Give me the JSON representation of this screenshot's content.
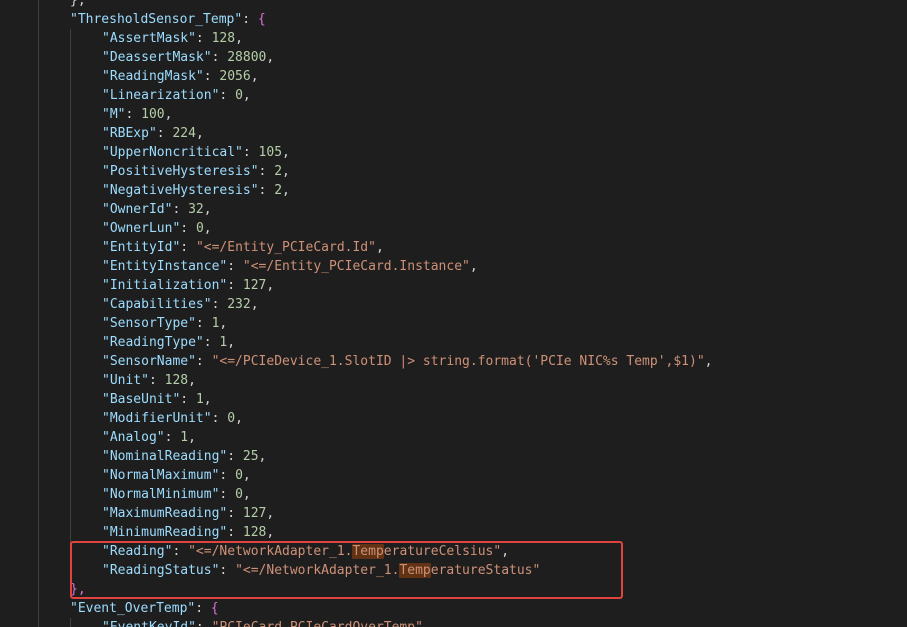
{
  "editor": {
    "lines": [
      {
        "indent": 1,
        "parts": [
          {
            "t": "},",
            "c": "punc"
          }
        ]
      },
      {
        "indent": 1,
        "parts": [
          {
            "t": "\"ThresholdSensor_Temp\"",
            "c": "key"
          },
          {
            "t": ": ",
            "c": "punc"
          },
          {
            "t": "{",
            "c": "brace2"
          }
        ]
      },
      {
        "indent": 2,
        "parts": [
          {
            "t": "\"AssertMask\"",
            "c": "key"
          },
          {
            "t": ": ",
            "c": "punc"
          },
          {
            "t": "128",
            "c": "num"
          },
          {
            "t": ",",
            "c": "punc"
          }
        ]
      },
      {
        "indent": 2,
        "parts": [
          {
            "t": "\"DeassertMask\"",
            "c": "key"
          },
          {
            "t": ": ",
            "c": "punc"
          },
          {
            "t": "28800",
            "c": "num"
          },
          {
            "t": ",",
            "c": "punc"
          }
        ]
      },
      {
        "indent": 2,
        "parts": [
          {
            "t": "\"ReadingMask\"",
            "c": "key"
          },
          {
            "t": ": ",
            "c": "punc"
          },
          {
            "t": "2056",
            "c": "num"
          },
          {
            "t": ",",
            "c": "punc"
          }
        ]
      },
      {
        "indent": 2,
        "parts": [
          {
            "t": "\"Linearization\"",
            "c": "key"
          },
          {
            "t": ": ",
            "c": "punc"
          },
          {
            "t": "0",
            "c": "num"
          },
          {
            "t": ",",
            "c": "punc"
          }
        ]
      },
      {
        "indent": 2,
        "parts": [
          {
            "t": "\"M\"",
            "c": "key"
          },
          {
            "t": ": ",
            "c": "punc"
          },
          {
            "t": "100",
            "c": "num"
          },
          {
            "t": ",",
            "c": "punc"
          }
        ]
      },
      {
        "indent": 2,
        "parts": [
          {
            "t": "\"RBExp\"",
            "c": "key"
          },
          {
            "t": ": ",
            "c": "punc"
          },
          {
            "t": "224",
            "c": "num"
          },
          {
            "t": ",",
            "c": "punc"
          }
        ]
      },
      {
        "indent": 2,
        "parts": [
          {
            "t": "\"UpperNoncritical\"",
            "c": "key"
          },
          {
            "t": ": ",
            "c": "punc"
          },
          {
            "t": "105",
            "c": "num"
          },
          {
            "t": ",",
            "c": "punc"
          }
        ]
      },
      {
        "indent": 2,
        "parts": [
          {
            "t": "\"PositiveHysteresis\"",
            "c": "key"
          },
          {
            "t": ": ",
            "c": "punc"
          },
          {
            "t": "2",
            "c": "num"
          },
          {
            "t": ",",
            "c": "punc"
          }
        ]
      },
      {
        "indent": 2,
        "parts": [
          {
            "t": "\"NegativeHysteresis\"",
            "c": "key"
          },
          {
            "t": ": ",
            "c": "punc"
          },
          {
            "t": "2",
            "c": "num"
          },
          {
            "t": ",",
            "c": "punc"
          }
        ]
      },
      {
        "indent": 2,
        "parts": [
          {
            "t": "\"OwnerId\"",
            "c": "key"
          },
          {
            "t": ": ",
            "c": "punc"
          },
          {
            "t": "32",
            "c": "num"
          },
          {
            "t": ",",
            "c": "punc"
          }
        ]
      },
      {
        "indent": 2,
        "parts": [
          {
            "t": "\"OwnerLun\"",
            "c": "key"
          },
          {
            "t": ": ",
            "c": "punc"
          },
          {
            "t": "0",
            "c": "num"
          },
          {
            "t": ",",
            "c": "punc"
          }
        ]
      },
      {
        "indent": 2,
        "parts": [
          {
            "t": "\"EntityId\"",
            "c": "key"
          },
          {
            "t": ": ",
            "c": "punc"
          },
          {
            "t": "\"<=/Entity_PCIeCard.Id\"",
            "c": "str"
          },
          {
            "t": ",",
            "c": "punc"
          }
        ]
      },
      {
        "indent": 2,
        "parts": [
          {
            "t": "\"EntityInstance\"",
            "c": "key"
          },
          {
            "t": ": ",
            "c": "punc"
          },
          {
            "t": "\"<=/Entity_PCIeCard.Instance\"",
            "c": "str"
          },
          {
            "t": ",",
            "c": "punc"
          }
        ]
      },
      {
        "indent": 2,
        "parts": [
          {
            "t": "\"Initialization\"",
            "c": "key"
          },
          {
            "t": ": ",
            "c": "punc"
          },
          {
            "t": "127",
            "c": "num"
          },
          {
            "t": ",",
            "c": "punc"
          }
        ]
      },
      {
        "indent": 2,
        "parts": [
          {
            "t": "\"Capabilities\"",
            "c": "key"
          },
          {
            "t": ": ",
            "c": "punc"
          },
          {
            "t": "232",
            "c": "num"
          },
          {
            "t": ",",
            "c": "punc"
          }
        ]
      },
      {
        "indent": 2,
        "parts": [
          {
            "t": "\"SensorType\"",
            "c": "key"
          },
          {
            "t": ": ",
            "c": "punc"
          },
          {
            "t": "1",
            "c": "num"
          },
          {
            "t": ",",
            "c": "punc"
          }
        ]
      },
      {
        "indent": 2,
        "parts": [
          {
            "t": "\"ReadingType\"",
            "c": "key"
          },
          {
            "t": ": ",
            "c": "punc"
          },
          {
            "t": "1",
            "c": "num"
          },
          {
            "t": ",",
            "c": "punc"
          }
        ]
      },
      {
        "indent": 2,
        "parts": [
          {
            "t": "\"SensorName\"",
            "c": "key"
          },
          {
            "t": ": ",
            "c": "punc"
          },
          {
            "t": "\"<=/PCIeDevice_1.SlotID |> string.format('PCIe NIC%s Temp',$1)\"",
            "c": "str"
          },
          {
            "t": ",",
            "c": "punc"
          }
        ]
      },
      {
        "indent": 2,
        "parts": [
          {
            "t": "\"Unit\"",
            "c": "key"
          },
          {
            "t": ": ",
            "c": "punc"
          },
          {
            "t": "128",
            "c": "num"
          },
          {
            "t": ",",
            "c": "punc"
          }
        ]
      },
      {
        "indent": 2,
        "parts": [
          {
            "t": "\"BaseUnit\"",
            "c": "key"
          },
          {
            "t": ": ",
            "c": "punc"
          },
          {
            "t": "1",
            "c": "num"
          },
          {
            "t": ",",
            "c": "punc"
          }
        ]
      },
      {
        "indent": 2,
        "parts": [
          {
            "t": "\"ModifierUnit\"",
            "c": "key"
          },
          {
            "t": ": ",
            "c": "punc"
          },
          {
            "t": "0",
            "c": "num"
          },
          {
            "t": ",",
            "c": "punc"
          }
        ]
      },
      {
        "indent": 2,
        "parts": [
          {
            "t": "\"Analog\"",
            "c": "key"
          },
          {
            "t": ": ",
            "c": "punc"
          },
          {
            "t": "1",
            "c": "num"
          },
          {
            "t": ",",
            "c": "punc"
          }
        ]
      },
      {
        "indent": 2,
        "parts": [
          {
            "t": "\"NominalReading\"",
            "c": "key"
          },
          {
            "t": ": ",
            "c": "punc"
          },
          {
            "t": "25",
            "c": "num"
          },
          {
            "t": ",",
            "c": "punc"
          }
        ]
      },
      {
        "indent": 2,
        "parts": [
          {
            "t": "\"NormalMaximum\"",
            "c": "key"
          },
          {
            "t": ": ",
            "c": "punc"
          },
          {
            "t": "0",
            "c": "num"
          },
          {
            "t": ",",
            "c": "punc"
          }
        ]
      },
      {
        "indent": 2,
        "parts": [
          {
            "t": "\"NormalMinimum\"",
            "c": "key"
          },
          {
            "t": ": ",
            "c": "punc"
          },
          {
            "t": "0",
            "c": "num"
          },
          {
            "t": ",",
            "c": "punc"
          }
        ]
      },
      {
        "indent": 2,
        "parts": [
          {
            "t": "\"MaximumReading\"",
            "c": "key"
          },
          {
            "t": ": ",
            "c": "punc"
          },
          {
            "t": "127",
            "c": "num"
          },
          {
            "t": ",",
            "c": "punc"
          }
        ]
      },
      {
        "indent": 2,
        "parts": [
          {
            "t": "\"MinimumReading\"",
            "c": "key"
          },
          {
            "t": ": ",
            "c": "punc"
          },
          {
            "t": "128",
            "c": "num"
          },
          {
            "t": ",",
            "c": "punc"
          }
        ]
      },
      {
        "indent": 2,
        "parts": [
          {
            "t": "\"Reading\"",
            "c": "key"
          },
          {
            "t": ": ",
            "c": "punc"
          },
          {
            "t": "\"<=/NetworkAdapter_1.",
            "c": "str"
          },
          {
            "t": "Temp",
            "c": "str hl"
          },
          {
            "t": "eratureCelsius\"",
            "c": "str"
          },
          {
            "t": ",",
            "c": "punc"
          }
        ]
      },
      {
        "indent": 2,
        "parts": [
          {
            "t": "\"ReadingStatus\"",
            "c": "key"
          },
          {
            "t": ": ",
            "c": "punc"
          },
          {
            "t": "\"<=/NetworkAdapter_1.",
            "c": "str"
          },
          {
            "t": "Temp",
            "c": "str hl"
          },
          {
            "t": "eratureStatus\"",
            "c": "str"
          }
        ]
      },
      {
        "indent": 1,
        "parts": [
          {
            "t": "},",
            "c": "brace2"
          }
        ]
      },
      {
        "indent": 1,
        "parts": [
          {
            "t": "\"Event_OverTemp\"",
            "c": "key"
          },
          {
            "t": ": ",
            "c": "punc"
          },
          {
            "t": "{",
            "c": "brace2"
          }
        ]
      },
      {
        "indent": 2,
        "parts": [
          {
            "t": "\"EventKeyId\"",
            "c": "key"
          },
          {
            "t": ": ",
            "c": "punc"
          },
          {
            "t": "\"PCIeCard.PCIeCardOverTemp\"",
            "c": "str"
          }
        ]
      }
    ]
  },
  "colors": {
    "background": "#1e1e1e",
    "key": "#9cdcfe",
    "string": "#ce9178",
    "number": "#b5cea8",
    "highlight_box": "#e0443e",
    "search_match": "#613214"
  }
}
